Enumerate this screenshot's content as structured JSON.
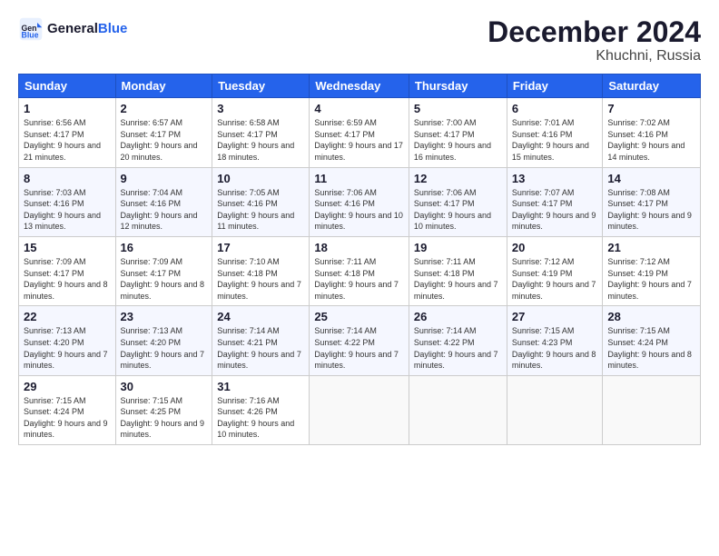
{
  "header": {
    "logo_line1": "General",
    "logo_line2": "Blue",
    "title": "December 2024",
    "subtitle": "Khuchni, Russia"
  },
  "weekdays": [
    "Sunday",
    "Monday",
    "Tuesday",
    "Wednesday",
    "Thursday",
    "Friday",
    "Saturday"
  ],
  "weeks": [
    [
      {
        "day": "1",
        "sunrise": "6:56 AM",
        "sunset": "4:17 PM",
        "daylight": "9 hours and 21 minutes."
      },
      {
        "day": "2",
        "sunrise": "6:57 AM",
        "sunset": "4:17 PM",
        "daylight": "9 hours and 20 minutes."
      },
      {
        "day": "3",
        "sunrise": "6:58 AM",
        "sunset": "4:17 PM",
        "daylight": "9 hours and 18 minutes."
      },
      {
        "day": "4",
        "sunrise": "6:59 AM",
        "sunset": "4:17 PM",
        "daylight": "9 hours and 17 minutes."
      },
      {
        "day": "5",
        "sunrise": "7:00 AM",
        "sunset": "4:17 PM",
        "daylight": "9 hours and 16 minutes."
      },
      {
        "day": "6",
        "sunrise": "7:01 AM",
        "sunset": "4:16 PM",
        "daylight": "9 hours and 15 minutes."
      },
      {
        "day": "7",
        "sunrise": "7:02 AM",
        "sunset": "4:16 PM",
        "daylight": "9 hours and 14 minutes."
      }
    ],
    [
      {
        "day": "8",
        "sunrise": "7:03 AM",
        "sunset": "4:16 PM",
        "daylight": "9 hours and 13 minutes."
      },
      {
        "day": "9",
        "sunrise": "7:04 AM",
        "sunset": "4:16 PM",
        "daylight": "9 hours and 12 minutes."
      },
      {
        "day": "10",
        "sunrise": "7:05 AM",
        "sunset": "4:16 PM",
        "daylight": "9 hours and 11 minutes."
      },
      {
        "day": "11",
        "sunrise": "7:06 AM",
        "sunset": "4:16 PM",
        "daylight": "9 hours and 10 minutes."
      },
      {
        "day": "12",
        "sunrise": "7:06 AM",
        "sunset": "4:17 PM",
        "daylight": "9 hours and 10 minutes."
      },
      {
        "day": "13",
        "sunrise": "7:07 AM",
        "sunset": "4:17 PM",
        "daylight": "9 hours and 9 minutes."
      },
      {
        "day": "14",
        "sunrise": "7:08 AM",
        "sunset": "4:17 PM",
        "daylight": "9 hours and 9 minutes."
      }
    ],
    [
      {
        "day": "15",
        "sunrise": "7:09 AM",
        "sunset": "4:17 PM",
        "daylight": "9 hours and 8 minutes."
      },
      {
        "day": "16",
        "sunrise": "7:09 AM",
        "sunset": "4:17 PM",
        "daylight": "9 hours and 8 minutes."
      },
      {
        "day": "17",
        "sunrise": "7:10 AM",
        "sunset": "4:18 PM",
        "daylight": "9 hours and 7 minutes."
      },
      {
        "day": "18",
        "sunrise": "7:11 AM",
        "sunset": "4:18 PM",
        "daylight": "9 hours and 7 minutes."
      },
      {
        "day": "19",
        "sunrise": "7:11 AM",
        "sunset": "4:18 PM",
        "daylight": "9 hours and 7 minutes."
      },
      {
        "day": "20",
        "sunrise": "7:12 AM",
        "sunset": "4:19 PM",
        "daylight": "9 hours and 7 minutes."
      },
      {
        "day": "21",
        "sunrise": "7:12 AM",
        "sunset": "4:19 PM",
        "daylight": "9 hours and 7 minutes."
      }
    ],
    [
      {
        "day": "22",
        "sunrise": "7:13 AM",
        "sunset": "4:20 PM",
        "daylight": "9 hours and 7 minutes."
      },
      {
        "day": "23",
        "sunrise": "7:13 AM",
        "sunset": "4:20 PM",
        "daylight": "9 hours and 7 minutes."
      },
      {
        "day": "24",
        "sunrise": "7:14 AM",
        "sunset": "4:21 PM",
        "daylight": "9 hours and 7 minutes."
      },
      {
        "day": "25",
        "sunrise": "7:14 AM",
        "sunset": "4:22 PM",
        "daylight": "9 hours and 7 minutes."
      },
      {
        "day": "26",
        "sunrise": "7:14 AM",
        "sunset": "4:22 PM",
        "daylight": "9 hours and 7 minutes."
      },
      {
        "day": "27",
        "sunrise": "7:15 AM",
        "sunset": "4:23 PM",
        "daylight": "9 hours and 8 minutes."
      },
      {
        "day": "28",
        "sunrise": "7:15 AM",
        "sunset": "4:24 PM",
        "daylight": "9 hours and 8 minutes."
      }
    ],
    [
      {
        "day": "29",
        "sunrise": "7:15 AM",
        "sunset": "4:24 PM",
        "daylight": "9 hours and 9 minutes."
      },
      {
        "day": "30",
        "sunrise": "7:15 AM",
        "sunset": "4:25 PM",
        "daylight": "9 hours and 9 minutes."
      },
      {
        "day": "31",
        "sunrise": "7:16 AM",
        "sunset": "4:26 PM",
        "daylight": "9 hours and 10 minutes."
      },
      null,
      null,
      null,
      null
    ]
  ]
}
